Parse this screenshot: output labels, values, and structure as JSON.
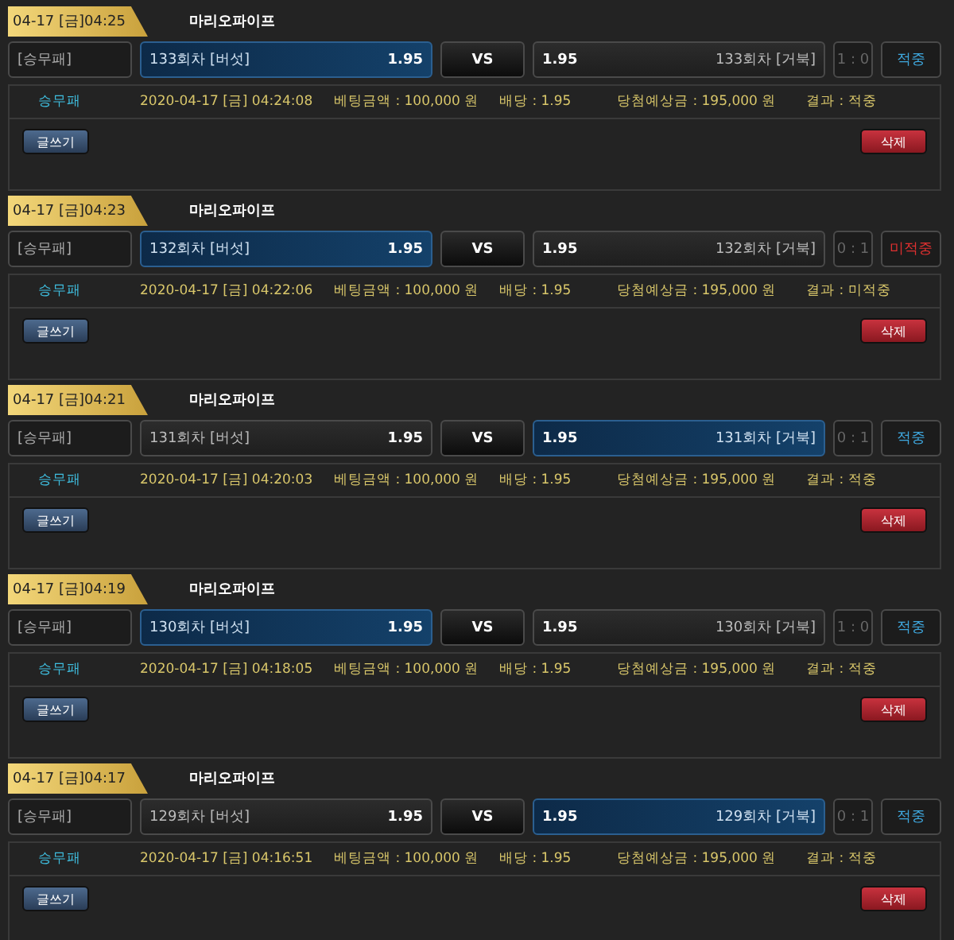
{
  "bets": [
    {
      "time": "04-17 [금]04:25",
      "title": "마리오파이프",
      "type": "[승무패]",
      "home": {
        "label": "133회차 [버섯]",
        "odds": "1.95",
        "selected": true
      },
      "vs": "VS",
      "away": {
        "odds": "1.95",
        "label": "133회차 [거북]",
        "selected": false
      },
      "score": "1 : 0",
      "result": {
        "text": "적중",
        "win": true
      },
      "info": {
        "type": "승무패",
        "datetime": "2020-04-17 [금] 04:24:08",
        "amount": "베팅금액 : 100,000 원",
        "odds": "배당 : 1.95",
        "expected": "당첨예상금 : 195,000 원",
        "result": "결과 : 적중"
      },
      "write_button": "글쓰기",
      "delete_button": "삭제"
    },
    {
      "time": "04-17 [금]04:23",
      "title": "마리오파이프",
      "type": "[승무패]",
      "home": {
        "label": "132회차 [버섯]",
        "odds": "1.95",
        "selected": true
      },
      "vs": "VS",
      "away": {
        "odds": "1.95",
        "label": "132회차 [거북]",
        "selected": false
      },
      "score": "0 : 1",
      "result": {
        "text": "미적중",
        "win": false
      },
      "info": {
        "type": "승무패",
        "datetime": "2020-04-17 [금] 04:22:06",
        "amount": "베팅금액 : 100,000 원",
        "odds": "배당 : 1.95",
        "expected": "당첨예상금 : 195,000 원",
        "result": "결과 : 미적중"
      },
      "write_button": "글쓰기",
      "delete_button": "삭제"
    },
    {
      "time": "04-17 [금]04:21",
      "title": "마리오파이프",
      "type": "[승무패]",
      "home": {
        "label": "131회차 [버섯]",
        "odds": "1.95",
        "selected": false
      },
      "vs": "VS",
      "away": {
        "odds": "1.95",
        "label": "131회차 [거북]",
        "selected": true
      },
      "score": "0 : 1",
      "result": {
        "text": "적중",
        "win": true
      },
      "info": {
        "type": "승무패",
        "datetime": "2020-04-17 [금] 04:20:03",
        "amount": "베팅금액 : 100,000 원",
        "odds": "배당 : 1.95",
        "expected": "당첨예상금 : 195,000 원",
        "result": "결과 : 적중"
      },
      "write_button": "글쓰기",
      "delete_button": "삭제"
    },
    {
      "time": "04-17 [금]04:19",
      "title": "마리오파이프",
      "type": "[승무패]",
      "home": {
        "label": "130회차 [버섯]",
        "odds": "1.95",
        "selected": true
      },
      "vs": "VS",
      "away": {
        "odds": "1.95",
        "label": "130회차 [거북]",
        "selected": false
      },
      "score": "1 : 0",
      "result": {
        "text": "적중",
        "win": true
      },
      "info": {
        "type": "승무패",
        "datetime": "2020-04-17 [금] 04:18:05",
        "amount": "베팅금액 : 100,000 원",
        "odds": "배당 : 1.95",
        "expected": "당첨예상금 : 195,000 원",
        "result": "결과 : 적중"
      },
      "write_button": "글쓰기",
      "delete_button": "삭제"
    },
    {
      "time": "04-17 [금]04:17",
      "title": "마리오파이프",
      "type": "[승무패]",
      "home": {
        "label": "129회차 [버섯]",
        "odds": "1.95",
        "selected": false
      },
      "vs": "VS",
      "away": {
        "odds": "1.95",
        "label": "129회차 [거북]",
        "selected": true
      },
      "score": "0 : 1",
      "result": {
        "text": "적중",
        "win": true
      },
      "info": {
        "type": "승무패",
        "datetime": "2020-04-17 [금] 04:16:51",
        "amount": "베팅금액 : 100,000 원",
        "odds": "배당 : 1.95",
        "expected": "당첨예상금 : 195,000 원",
        "result": "결과 : 적중"
      },
      "write_button": "글쓰기",
      "delete_button": "삭제"
    }
  ]
}
